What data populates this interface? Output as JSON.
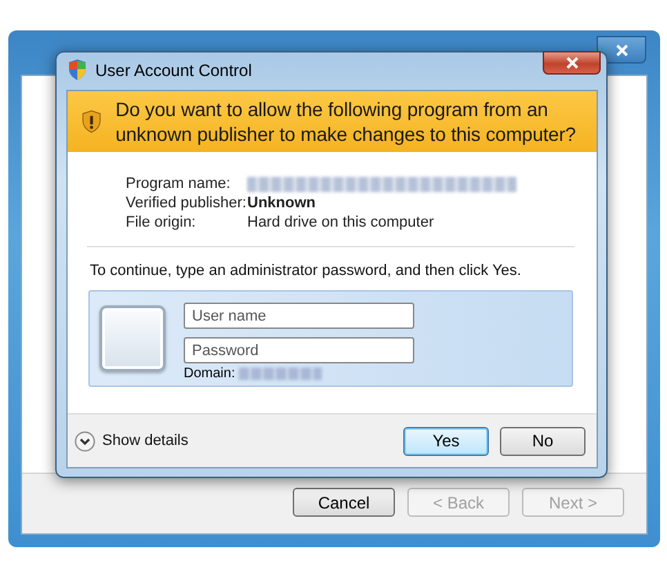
{
  "background_window": {
    "buttons": [
      {
        "label": "Cancel",
        "disabled": false
      },
      {
        "label": "< Back",
        "disabled": true
      },
      {
        "label": "Next >",
        "disabled": true
      }
    ]
  },
  "dialog": {
    "title": "User Account Control",
    "question": "Do you want to allow the following program from an unknown publisher to make changes to this computer?",
    "details": [
      {
        "label": "Program name:",
        "kind": "blurred"
      },
      {
        "label": "Verified publisher:",
        "value": "Unknown",
        "kind": "bold"
      },
      {
        "label": "File origin:",
        "value": "Hard drive on this computer",
        "kind": "text"
      }
    ],
    "instruction": "To continue, type an administrator password, and then click Yes.",
    "fields": [
      {
        "placeholder": "User name"
      },
      {
        "placeholder": "Password"
      }
    ],
    "domain": {
      "label": "Domain:"
    },
    "details_toggle": {
      "label": "Show details",
      "expanded": false
    },
    "buttons": [
      {
        "label": "Yes",
        "default": true
      },
      {
        "label": "No",
        "default": false
      }
    ]
  }
}
